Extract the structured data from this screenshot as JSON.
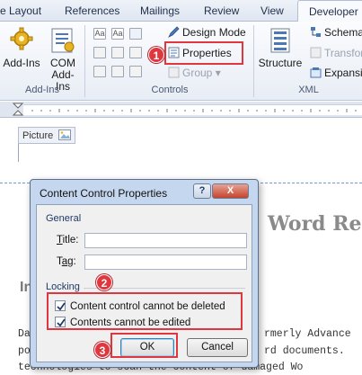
{
  "ribbon_tabs": [
    "e Layout",
    "References",
    "Mailings",
    "Review",
    "View",
    "Developer"
  ],
  "ribbon": {
    "addins_group": {
      "label": "Add-Ins",
      "addins_button": "Add-Ins",
      "com_addins_line1": "COM",
      "com_addins_line2": "Add-Ins"
    },
    "controls_group": {
      "label": "Controls",
      "design_mode": "Design Mode",
      "properties": "Properties",
      "group": "Group"
    },
    "xml_group": {
      "label": "XML",
      "structure": "Structure",
      "schema": "Schema",
      "transform": "Transfor",
      "expansion": "Expansi"
    }
  },
  "document": {
    "picture_tag": "Picture",
    "heading_fragment": "Word Re",
    "subheading_fragment": "In",
    "line1_left": "Da",
    "line1_right": "rmerly Advance",
    "line2_left": "po",
    "line2_right": "rd documents.",
    "line3": "technologies to scan the content of damaged Wo"
  },
  "dialog": {
    "title": "Content Control Properties",
    "help_label": "?",
    "close_label": "X",
    "general_section": "General",
    "title_label": "Title:",
    "title_accesskey": "T",
    "title_rest": "itle:",
    "title_value": "",
    "tag_label": "Tag:",
    "tag_before": "T",
    "tag_accesskey": "a",
    "tag_rest": "g:",
    "tag_value": "",
    "locking_section": "Locking",
    "chk_delete_label": "Content control cannot be deleted",
    "chk_delete_checked": true,
    "chk_edit_label": "Contents cannot be edited",
    "chk_edit_checked": true,
    "ok_label": "OK",
    "cancel_label": "Cancel"
  },
  "annotations": {
    "badge1": "1",
    "badge2": "2",
    "badge3": "3",
    "highlight_color": "#e0373f"
  }
}
